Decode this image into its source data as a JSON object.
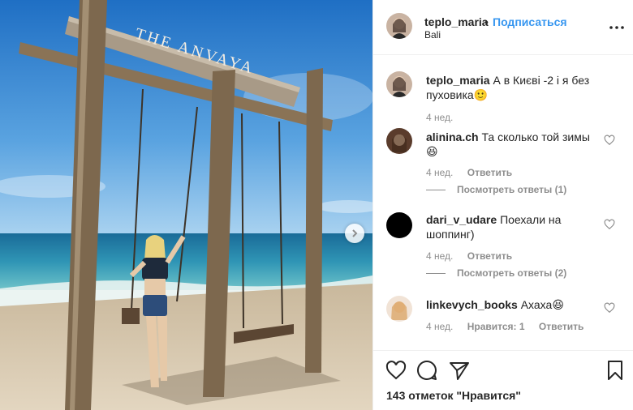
{
  "post": {
    "username": "teplo_maria",
    "separator": "•",
    "follow_label": "Подписаться",
    "location": "Bali",
    "more_icon": "more-horizontal-icon"
  },
  "photo": {
    "description_icon": "beach-swing-photo",
    "sign_text": "THE ANVAYA",
    "next_icon": "chevron-right-icon"
  },
  "caption": {
    "username": "teplo_maria",
    "text": "А в Києві -2 і я без пуховика🙂",
    "time": "4 нед."
  },
  "comments": [
    {
      "username": "alinina.ch",
      "text": "Та сколько той зимы 😆",
      "time": "4 нед.",
      "reply_label": "Ответить",
      "replies_label": "Посмотреть ответы (1)"
    },
    {
      "username": "dari_v_udare",
      "text": "Поехали на шоппинг)",
      "time": "4 нед.",
      "reply_label": "Ответить",
      "replies_label": "Посмотреть ответы (2)"
    },
    {
      "username": "linkevych_books",
      "text": "Ахаха😆",
      "time": "4 нед.",
      "likes_label": "Нравится: 1",
      "reply_label": "Ответить"
    }
  ],
  "actions": {
    "like_icon": "heart-icon",
    "comment_icon": "comment-icon",
    "share_icon": "share-icon",
    "save_icon": "bookmark-icon",
    "likes_text": "143 отметок \"Нравится\""
  },
  "colors": {
    "link": "#3897f0",
    "muted": "#8e8e8e",
    "text": "#262626",
    "divider": "#efefef"
  }
}
